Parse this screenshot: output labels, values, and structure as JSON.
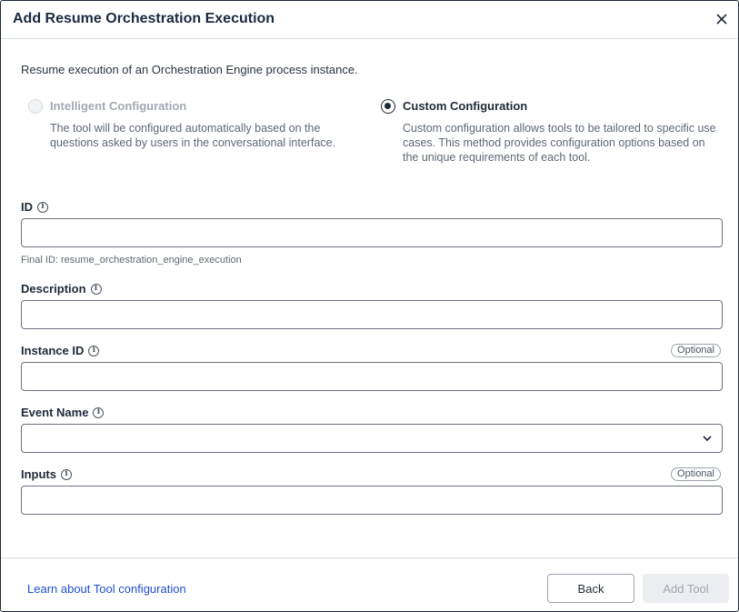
{
  "dialog": {
    "title": "Add Resume Orchestration Execution",
    "description": "Resume execution of an Orchestration Engine process instance."
  },
  "options": {
    "intelligent": {
      "label": "Intelligent Configuration",
      "description": "The tool will be configured automatically based on the questions asked by users in the conversational interface.",
      "selected": false,
      "disabled": true
    },
    "custom": {
      "label": "Custom Configuration",
      "description": "Custom configuration allows tools to be tailored to specific use cases. This method provides configuration options based on the unique requirements of each tool.",
      "selected": true
    }
  },
  "fields": {
    "id": {
      "label": "ID",
      "value": "",
      "hint": "Final ID: resume_orchestration_engine_execution"
    },
    "description": {
      "label": "Description",
      "value": ""
    },
    "instance_id": {
      "label": "Instance ID",
      "value": "",
      "badge": "Optional"
    },
    "event_name": {
      "label": "Event Name",
      "value": ""
    },
    "inputs": {
      "label": "Inputs",
      "value": "",
      "badge": "Optional"
    }
  },
  "footer": {
    "learn_link": "Learn about Tool configuration",
    "back_label": "Back",
    "add_label": "Add Tool"
  },
  "icons": {
    "close": "close-icon",
    "info": "info-icon",
    "chevron": "chevron-down-icon"
  }
}
